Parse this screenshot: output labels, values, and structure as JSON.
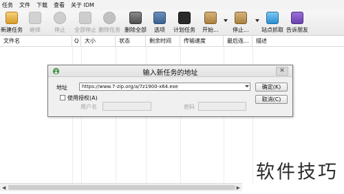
{
  "menu": [
    "任务",
    "文件",
    "下载",
    "查看",
    "关于 IDM"
  ],
  "toolbar": {
    "new_task": "新建任务",
    "resume": "继续",
    "stop": "停止",
    "stop_all": "全部停止",
    "delete_task": "删除任务",
    "delete_all": "删除全部",
    "options": "选项",
    "scheduler": "计划任务",
    "start_queue": "开始...",
    "stop_queue": "停止...",
    "site_grabber": "站点抓取",
    "tell_friend": "告诉朋友"
  },
  "columns": [
    "文件名",
    "Q",
    "大小",
    "状态",
    "剩余时间",
    "传输速度",
    "最后连...",
    "描述"
  ],
  "dialog": {
    "title": "输入新任务的地址",
    "address_label": "地址",
    "address_value": "https://www.7-zip.org/a/7z1900-x64.exe",
    "use_auth_label": "使用授权(A)",
    "username_label": "用户名",
    "password_label": "密码",
    "ok_label": "确定(K)",
    "cancel_label": "取消(C)",
    "close_glyph": "✕"
  },
  "watermark": "软件技巧",
  "colors": {
    "accent": "#4a86c8",
    "disabled_text": "#9a9a9a"
  }
}
